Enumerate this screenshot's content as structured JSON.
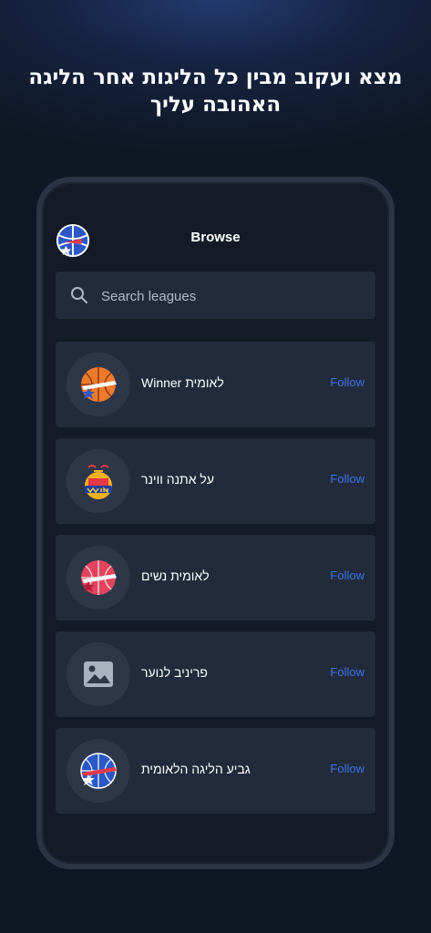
{
  "headline": "מצא ועקוב מבין כל הליגות אחר הליגה האהובה עליך",
  "screen_title": "Browse",
  "search": {
    "placeholder": "Search leagues"
  },
  "follow_label": "Follow",
  "leagues": [
    {
      "name": "לאומית Winner",
      "logo": "basketball-orange-logo-icon"
    },
    {
      "name": "על אתנה ווינר",
      "logo": "winner-logo-icon"
    },
    {
      "name": "לאומית נשים",
      "logo": "basketball-red-logo-icon"
    },
    {
      "name": "פריניב לנוער",
      "logo": "image-placeholder-icon"
    },
    {
      "name": "גביע הליגה הלאומית",
      "logo": "basketball-blue-logo-icon"
    }
  ],
  "colors": {
    "accent": "#3d74e6",
    "card": "#222b3b",
    "background": "#0f1724"
  }
}
